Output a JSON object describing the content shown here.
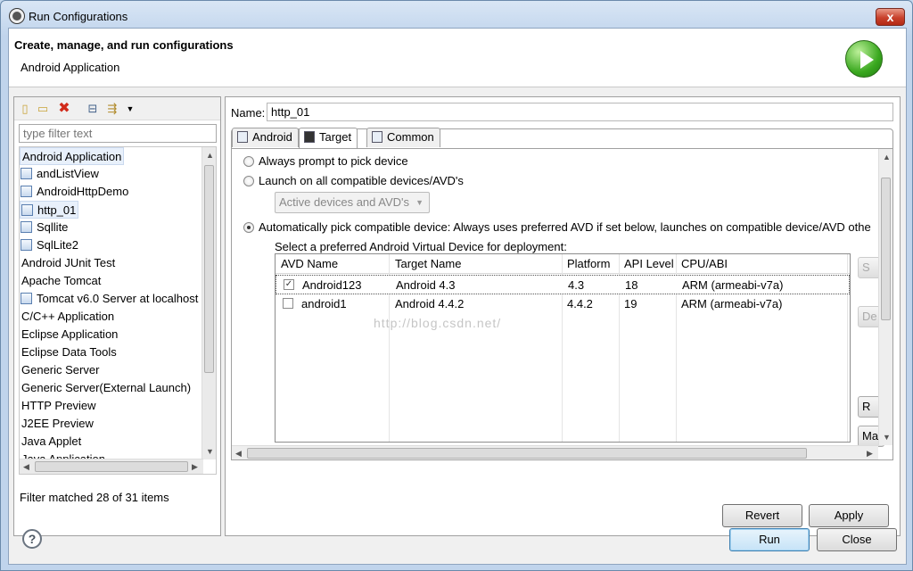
{
  "window": {
    "title": "Run Configurations",
    "close": "x"
  },
  "header": {
    "title": "Create, manage, and run configurations",
    "subtitle": "Android Application"
  },
  "left": {
    "filter_placeholder": "type filter text",
    "tree": [
      {
        "label": "Android Application",
        "indent": 0,
        "icon": false,
        "selected": true
      },
      {
        "label": "andListView",
        "indent": 1,
        "icon": true
      },
      {
        "label": "AndroidHttpDemo",
        "indent": 1,
        "icon": true
      },
      {
        "label": "http_01",
        "indent": 1,
        "icon": true,
        "selected": true
      },
      {
        "label": "Sqllite",
        "indent": 1,
        "icon": true
      },
      {
        "label": "SqlLite2",
        "indent": 1,
        "icon": true
      },
      {
        "label": "Android JUnit Test",
        "indent": 0,
        "icon": false
      },
      {
        "label": "Apache Tomcat",
        "indent": 0,
        "icon": false
      },
      {
        "label": "Tomcat v6.0 Server at localhost",
        "indent": 1,
        "icon": true
      },
      {
        "label": "C/C++ Application",
        "indent": 0,
        "icon": false
      },
      {
        "label": "Eclipse Application",
        "indent": 0,
        "icon": false
      },
      {
        "label": "Eclipse Data Tools",
        "indent": 0,
        "icon": false
      },
      {
        "label": "Generic Server",
        "indent": 0,
        "icon": false
      },
      {
        "label": "Generic Server(External Launch)",
        "indent": 0,
        "icon": false
      },
      {
        "label": "HTTP Preview",
        "indent": 0,
        "icon": false
      },
      {
        "label": "J2EE Preview",
        "indent": 0,
        "icon": false
      },
      {
        "label": "Java Applet",
        "indent": 0,
        "icon": false
      },
      {
        "label": "Java Application",
        "indent": 0,
        "icon": false
      }
    ],
    "status": "Filter matched 28 of 31 items"
  },
  "right": {
    "name_label": "Name:",
    "name_value": "http_01",
    "tabs": [
      "Android",
      "Target",
      "Common"
    ],
    "radio_pick": "Always prompt to pick device",
    "radio_all": "Launch on all compatible devices/AVD's",
    "combo_value": "Active devices and AVD's",
    "radio_auto": "Automatically pick compatible device: Always uses preferred AVD if set below, launches on compatible device/AVD othe",
    "select_label": "Select a preferred Android Virtual Device for deployment:",
    "table": {
      "headers": [
        "AVD Name",
        "Target Name",
        "Platform",
        "API Level",
        "CPU/ABI"
      ],
      "rows": [
        {
          "checked": true,
          "name": "Android123",
          "target": "Android 4.3",
          "platform": "4.3",
          "api": "18",
          "cpu": "ARM (armeabi-v7a)"
        },
        {
          "checked": false,
          "name": "android1",
          "target": "Android 4.4.2",
          "platform": "4.4.2",
          "api": "19",
          "cpu": "ARM (armeabi-v7a)"
        }
      ]
    },
    "side_buttons": [
      "S",
      "De",
      "R",
      "Ma"
    ],
    "watermark": "http://blog.csdn.net/"
  },
  "buttons": {
    "revert": "Revert",
    "apply": "Apply",
    "run": "Run",
    "close": "Close",
    "help": "?"
  }
}
